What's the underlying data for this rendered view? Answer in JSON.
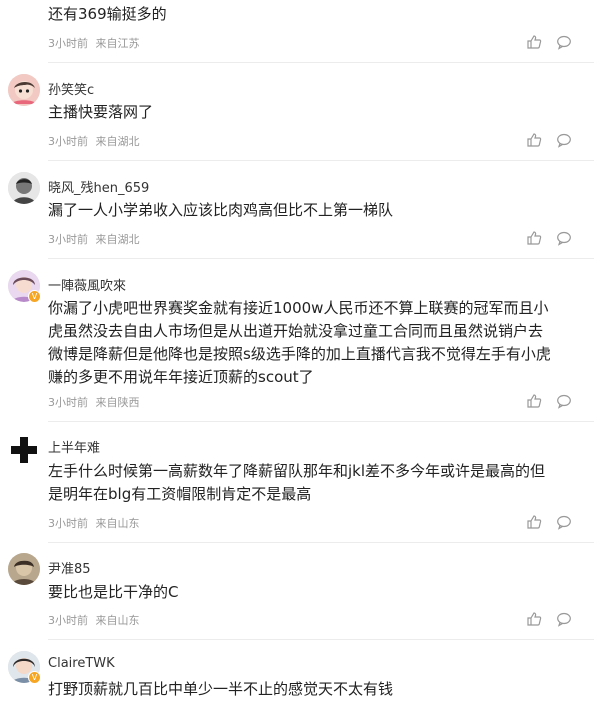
{
  "comments": [
    {
      "user": "",
      "text": "还有369输挺多的",
      "time": "3小时前",
      "loc": "来自江苏"
    },
    {
      "user": "孙笑笑c",
      "text": "主播快要落网了",
      "time": "3小时前",
      "loc": "来自湖北"
    },
    {
      "user": "晓风_残hen_659",
      "text": "漏了一人小学弟收入应该比肉鸡高但比不上第一梯队",
      "time": "3小时前",
      "loc": "来自湖北"
    },
    {
      "user": "一陣薇風吹來",
      "lines": [
        "你漏了小虎吧世界赛奖金就有接近1000w人民币还不算上联赛的冠军而且小",
        "虎虽然没去自由人市场但是从出道开始就没拿过童工合同而且虽然说销户去",
        "微博是降薪但是他降也是按照s级选手降的加上直播代言我不觉得左手有小虎",
        "赚的多更不用说年年接近顶薪的scout了"
      ],
      "time": "3小时前",
      "loc": "来自陕西"
    },
    {
      "user": "上半年难",
      "lines": [
        "左手什么时候第一高薪数年了降薪留队那年和jkl差不多今年或许是最高的但",
        "是明年在blg有工资帽限制肯定不是最高"
      ],
      "time": "3小时前",
      "loc": "来自山东"
    },
    {
      "user": "尹准85",
      "text": "要比也是比干净的C",
      "time": "3小时前",
      "loc": "来自山东"
    },
    {
      "user": "ClaireTWK",
      "text": "打野顶薪就几百比中单少一半不止的感觉天不太有钱"
    }
  ]
}
